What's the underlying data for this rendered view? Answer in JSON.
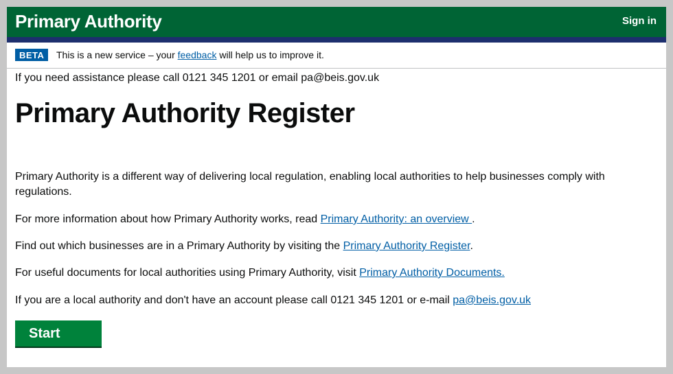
{
  "header": {
    "title": "Primary Authority",
    "signin": "Sign in"
  },
  "beta": {
    "tag": "BETA",
    "msg_before": "This is a new service – your ",
    "feedback_link": "feedback",
    "msg_after": " will help us to improve it."
  },
  "assistance": "If you need assistance please call 0121 345 1201 or email pa@beis.gov.uk",
  "page_title": "Primary Authority Register",
  "paragraphs": {
    "intro": "Primary Authority is a different way of delivering local regulation, enabling local authorities to help businesses comply with regulations.",
    "more_info_before": "For more information about how Primary Authority works, read ",
    "more_info_link": "Primary Authority: an overview ",
    "more_info_after": ".",
    "find_before": "Find out which businesses are in a Primary Authority by visiting the ",
    "find_link": "Primary Authority Register",
    "find_after": ".",
    "docs_before": "For useful documents for local authorities using Primary Authority, visit ",
    "docs_link": "Primary Authority Documents.",
    "account_before": "If you are a local authority and don't have an account please call 0121 345 1201 or e-mail ",
    "account_link": "pa@beis.gov.uk"
  },
  "start_button": "Start",
  "colors": {
    "header_green": "#006435",
    "header_bar": "#1d2f6e",
    "beta_blue": "#005ea5",
    "link": "#005ea5",
    "button_green": "#00823b"
  }
}
